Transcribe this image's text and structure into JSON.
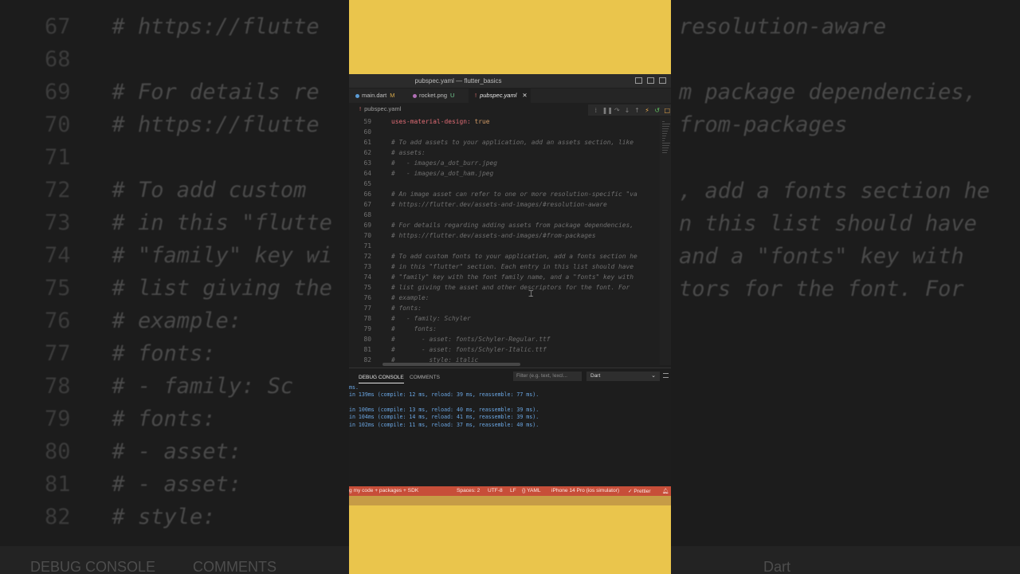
{
  "window": {
    "title": "pubspec.yaml — flutter_basics"
  },
  "tabs": [
    {
      "name": "main.dart",
      "status": "M"
    },
    {
      "name": "rocket.png",
      "status": "U"
    },
    {
      "name": "pubspec.yaml",
      "status": ""
    }
  ],
  "breadcrumb": "pubspec.yaml",
  "code_lines": [
    {
      "n": "59",
      "t": "uses-material-design: true"
    },
    {
      "n": "60",
      "t": ""
    },
    {
      "n": "61",
      "t": "# To add assets to your application, add an assets section, like"
    },
    {
      "n": "62",
      "t": "# assets:"
    },
    {
      "n": "63",
      "t": "#   - images/a_dot_burr.jpeg"
    },
    {
      "n": "64",
      "t": "#   - images/a_dot_ham.jpeg"
    },
    {
      "n": "65",
      "t": ""
    },
    {
      "n": "66",
      "t": "# An image asset can refer to one or more resolution-specific \"va"
    },
    {
      "n": "67",
      "t": "# https://flutter.dev/assets-and-images/#resolution-aware"
    },
    {
      "n": "68",
      "t": ""
    },
    {
      "n": "69",
      "t": "# For details regarding adding assets from package dependencies,"
    },
    {
      "n": "70",
      "t": "# https://flutter.dev/assets-and-images/#from-packages"
    },
    {
      "n": "71",
      "t": ""
    },
    {
      "n": "72",
      "t": "# To add custom fonts to your application, add a fonts section he"
    },
    {
      "n": "73",
      "t": "# in this \"flutter\" section. Each entry in this list should have"
    },
    {
      "n": "74",
      "t": "# \"family\" key with the font family name, and a \"fonts\" key with"
    },
    {
      "n": "75",
      "t": "# list giving the asset and other descriptors for the font. For"
    },
    {
      "n": "76",
      "t": "# example:"
    },
    {
      "n": "77",
      "t": "# fonts:"
    },
    {
      "n": "78",
      "t": "#   - family: Schyler"
    },
    {
      "n": "79",
      "t": "#     fonts:"
    },
    {
      "n": "80",
      "t": "#       - asset: fonts/Schyler-Regular.ttf"
    },
    {
      "n": "81",
      "t": "#       - asset: fonts/Schyler-Italic.ttf"
    },
    {
      "n": "82",
      "t": "#         style: italic"
    }
  ],
  "panel": {
    "tabs": [
      "DEBUG CONSOLE",
      "COMMENTS"
    ],
    "filter_placeholder": "Filter (e.g. text, !excl...",
    "selected": "Dart",
    "console": [
      "ms.",
      "in 139ms (compile: 12 ms, reload: 39 ms, reassemble: 77 ms).",
      "",
      "in 100ms (compile: 13 ms, reload: 40 ms, reassemble: 39 ms).",
      "in 104ms (compile: 14 ms, reload: 41 ms, reassemble: 39 ms).",
      "in 102ms (compile: 11 ms, reload: 37 ms, reassemble: 40 ms)."
    ]
  },
  "status": {
    "left": "g my code + packages + SDK",
    "spaces": "Spaces: 2",
    "encoding": "UTF-8",
    "eol": "LF",
    "language": "{} YAML",
    "device": "iPhone 14 Pro (ios simulator)",
    "prettier": "✓ Prettier"
  },
  "backdrop": {
    "lines": [
      {
        "n": "67",
        "t": "# https://flutte"
      },
      {
        "n": "68",
        "t": ""
      },
      {
        "n": "69",
        "t": "# For details re"
      },
      {
        "n": "70",
        "t": "# https://flutte"
      },
      {
        "n": "71",
        "t": ""
      },
      {
        "n": "72",
        "t": "# To add custom"
      },
      {
        "n": "73",
        "t": "# in this \"flutte"
      },
      {
        "n": "74",
        "t": "# \"family\" key wi"
      },
      {
        "n": "75",
        "t": "# list giving the"
      },
      {
        "n": "76",
        "t": "# example:"
      },
      {
        "n": "77",
        "t": "# fonts:"
      },
      {
        "n": "78",
        "t": "#   - family: Sc"
      },
      {
        "n": "79",
        "t": "#     fonts:"
      },
      {
        "n": "80",
        "t": "#       - asset:"
      },
      {
        "n": "81",
        "t": "#       - asset:"
      },
      {
        "n": "82",
        "t": "#         style:"
      }
    ],
    "right_lines": [
      "resolution-aware",
      "m package dependencies,",
      "from-packages",
      ", add a fonts section he",
      "n this list should have",
      "and a \"fonts\" key with",
      "tors for the font. For"
    ],
    "bottom_tabs": [
      "DEBUG CONSOLE",
      "COMMENTS"
    ],
    "bottom_select": "Dart"
  },
  "colors": {
    "frame": "#eac54c",
    "statusbar": "#c74e39",
    "console_text": "#6aa6e3"
  }
}
